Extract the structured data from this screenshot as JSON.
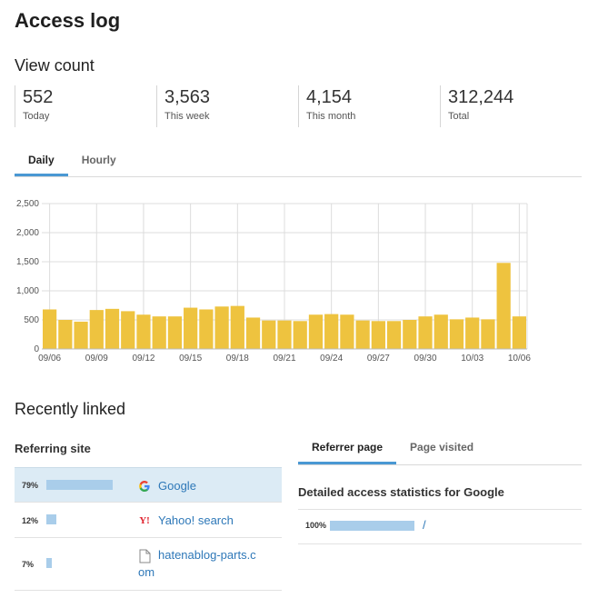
{
  "page_title": "Access log",
  "view_count": {
    "title": "View count",
    "stats": [
      {
        "value": "552",
        "label": "Today"
      },
      {
        "value": "3,563",
        "label": "This week"
      },
      {
        "value": "4,154",
        "label": "This month"
      },
      {
        "value": "312,244",
        "label": "Total"
      }
    ]
  },
  "chart_tabs": [
    "Daily",
    "Hourly"
  ],
  "chart_data": {
    "type": "bar",
    "categories": [
      "09/06",
      "09/07",
      "09/08",
      "09/09",
      "09/10",
      "09/11",
      "09/12",
      "09/13",
      "09/14",
      "09/15",
      "09/16",
      "09/17",
      "09/18",
      "09/19",
      "09/20",
      "09/21",
      "09/22",
      "09/23",
      "09/24",
      "09/25",
      "09/26",
      "09/27",
      "09/28",
      "09/29",
      "09/30",
      "10/01",
      "10/02",
      "10/03",
      "10/04",
      "10/05",
      "10/06"
    ],
    "tick_labels": [
      "09/06",
      "09/09",
      "09/12",
      "09/15",
      "09/18",
      "09/21",
      "09/24",
      "09/27",
      "09/30",
      "10/03",
      "10/06"
    ],
    "values": [
      680,
      500,
      470,
      670,
      690,
      650,
      590,
      560,
      560,
      710,
      680,
      730,
      740,
      540,
      490,
      490,
      480,
      590,
      600,
      590,
      490,
      480,
      480,
      500,
      560,
      590,
      510,
      540,
      510,
      1480,
      560
    ],
    "ylim": [
      0,
      2500
    ],
    "yticks": [
      "0",
      "500",
      "1,000",
      "1,500",
      "2,000",
      "2,500"
    ],
    "bar_color": "#eec33f",
    "grid": true
  },
  "recently_linked": {
    "title": "Recently linked",
    "referring_title": "Referring site",
    "sites": [
      {
        "pct": "79%",
        "fraction": 0.79,
        "icon": "google-icon",
        "name": "Google"
      },
      {
        "pct": "12%",
        "fraction": 0.12,
        "icon": "yahoo-icon",
        "name": "Yahoo! search"
      },
      {
        "pct": "7%",
        "fraction": 0.07,
        "icon": "document-icon",
        "name": "hatenablog-parts.com"
      }
    ],
    "detail_tabs": [
      "Referrer page",
      "Page visited"
    ],
    "detail_title": "Detailed access statistics for Google",
    "detail_rows": [
      {
        "pct": "100%",
        "fraction": 1.0,
        "path": "/"
      }
    ]
  },
  "colors": {
    "accent": "#4a98d3",
    "link": "#2e78b8",
    "bar": "#eec33f",
    "ref_bar": "#a9cdea",
    "selected_row": "#dcebf5"
  }
}
